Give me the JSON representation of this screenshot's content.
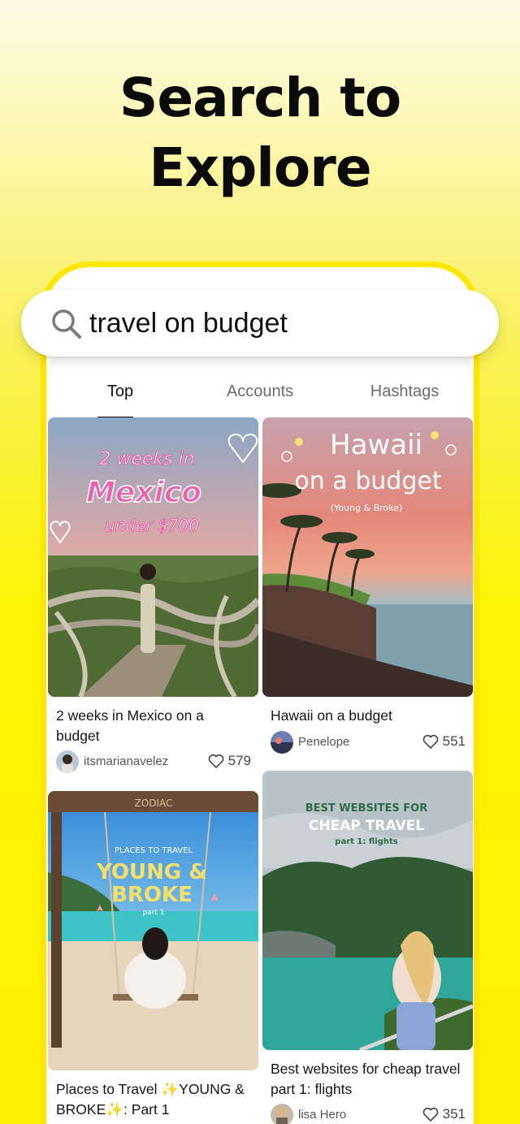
{
  "headline": {
    "line1": "Search to",
    "line2": "Explore"
  },
  "search": {
    "value": "travel on budget",
    "icon": "search-icon"
  },
  "tabs": [
    {
      "label": "Top",
      "active": true
    },
    {
      "label": "Accounts",
      "active": false
    },
    {
      "label": "Hashtags",
      "active": false
    }
  ],
  "posts": [
    {
      "title": "2 weeks in Mexico on a budget",
      "overlay": {
        "line1": "2 weeks in",
        "line2": "Mexico",
        "line3": "under $700"
      },
      "username": "itsmarianavelez",
      "likes": "579"
    },
    {
      "title": "Hawaii on a budget",
      "overlay": {
        "line1": "Hawaii",
        "line2": "on a budget",
        "line3": "(Young & Broke)"
      },
      "username": "Penelope",
      "likes": "551"
    },
    {
      "title": "Places to Travel ✨YOUNG & BROKE✨: Part 1",
      "overlay": {
        "line1": "ZODIAC",
        "line2": "PLACES TO TRAVEL",
        "line3": "YOUNG &",
        "line4": "BROKE",
        "line5": "part 1"
      },
      "username": "",
      "likes": ""
    },
    {
      "title": "Best websites for cheap travel part 1: flights",
      "overlay": {
        "line1": "BEST WEBSITES FOR",
        "line2": "CHEAP TRAVEL",
        "line3": "part 1: flights"
      },
      "username": "lisa Hero",
      "likes": "351"
    }
  ],
  "colors": {
    "background": "#fff200",
    "phone_frame": "#ffe600",
    "accent_text": "#111111"
  }
}
